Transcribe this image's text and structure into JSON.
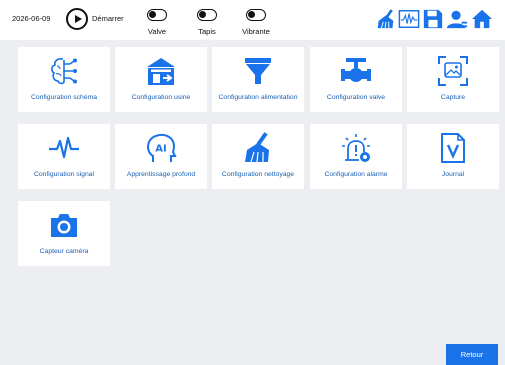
{
  "header": {
    "date": "2026-06-09",
    "start_label": "Démarrer",
    "toggles": [
      {
        "label": "Valve"
      },
      {
        "label": "Tapis"
      },
      {
        "label": "Vibrante"
      }
    ],
    "icons": [
      "broom-icon",
      "waveform-icon",
      "save-icon",
      "user-icon",
      "home-icon"
    ]
  },
  "tiles": [
    {
      "label": "Configuration schéma",
      "icon": "brain-circuit-icon"
    },
    {
      "label": "Configuration usine",
      "icon": "factory-icon"
    },
    {
      "label": "Configuration alimentation",
      "icon": "funnel-icon"
    },
    {
      "label": "Configuration valve",
      "icon": "valve-icon"
    },
    {
      "label": "Capture",
      "icon": "image-capture-icon"
    },
    {
      "label": "Configuration signal",
      "icon": "pulse-icon"
    },
    {
      "label": "Apprentissage profond",
      "icon": "ai-head-icon"
    },
    {
      "label": "Configuration nettoyage",
      "icon": "broom-icon"
    },
    {
      "label": "Configuration alarme",
      "icon": "alarm-gear-icon"
    },
    {
      "label": "Journal",
      "icon": "journal-file-icon"
    },
    {
      "label": "Capteur caméra",
      "icon": "camera-icon"
    }
  ],
  "footer": {
    "back_label": "Retour"
  },
  "colors": {
    "accent": "#1a73e8",
    "background": "#eceef1",
    "tile": "#ffffff"
  }
}
